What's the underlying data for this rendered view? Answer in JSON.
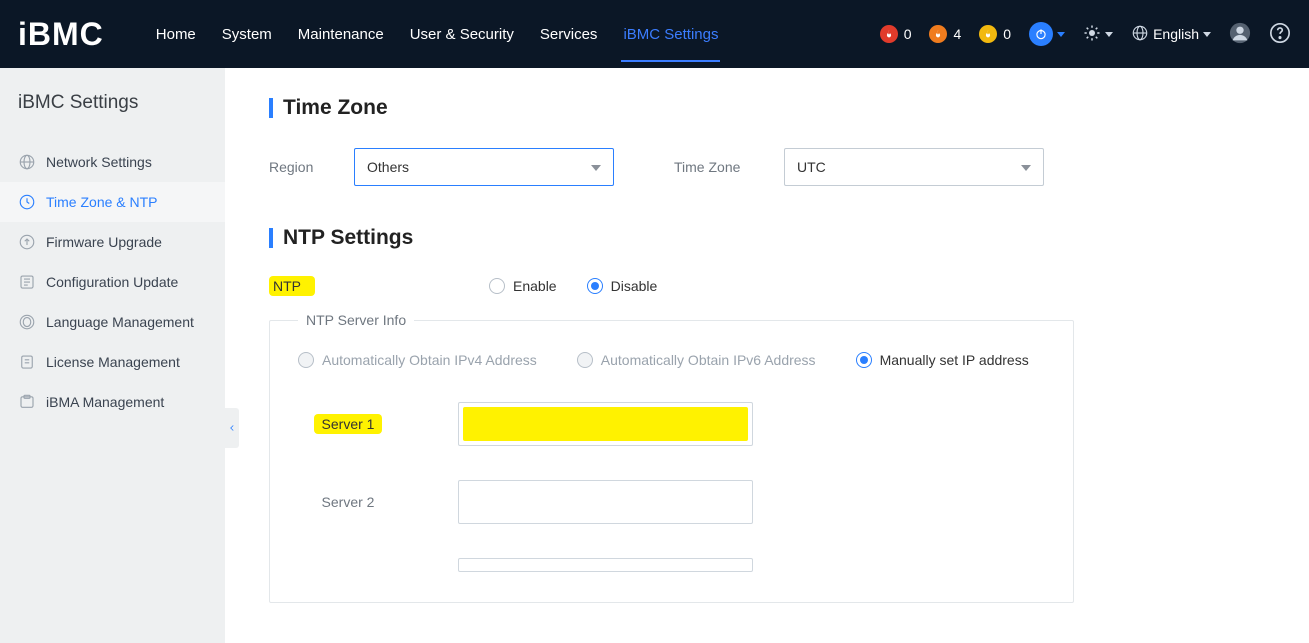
{
  "logo": "iBMC",
  "nav": {
    "home": "Home",
    "system": "System",
    "maintenance": "Maintenance",
    "user_security": "User & Security",
    "services": "Services",
    "ibmc_settings": "iBMC Settings"
  },
  "status": {
    "critical": "0",
    "major": "4",
    "minor": "0"
  },
  "lang": "English",
  "sidebar": {
    "title": "iBMC Settings",
    "items": [
      {
        "label": "Network Settings"
      },
      {
        "label": "Time Zone & NTP"
      },
      {
        "label": "Firmware Upgrade"
      },
      {
        "label": "Configuration Update"
      },
      {
        "label": "Language Management"
      },
      {
        "label": "License Management"
      },
      {
        "label": "iBMA Management"
      }
    ]
  },
  "timezone": {
    "heading": "Time Zone",
    "region_label": "Region",
    "region_value": "Others",
    "tz_label": "Time Zone",
    "tz_value": "UTC"
  },
  "ntp": {
    "heading": "NTP Settings",
    "label": "NTP",
    "enable": "Enable",
    "disable": "Disable",
    "fieldset": "NTP Server Info",
    "mode_auto_v4": "Automatically Obtain IPv4 Address",
    "mode_auto_v6": "Automatically Obtain IPv6 Address",
    "mode_manual": "Manually set IP address",
    "server1_label": "Server 1",
    "server1_value": "",
    "server2_label": "Server 2",
    "server2_value": ""
  }
}
